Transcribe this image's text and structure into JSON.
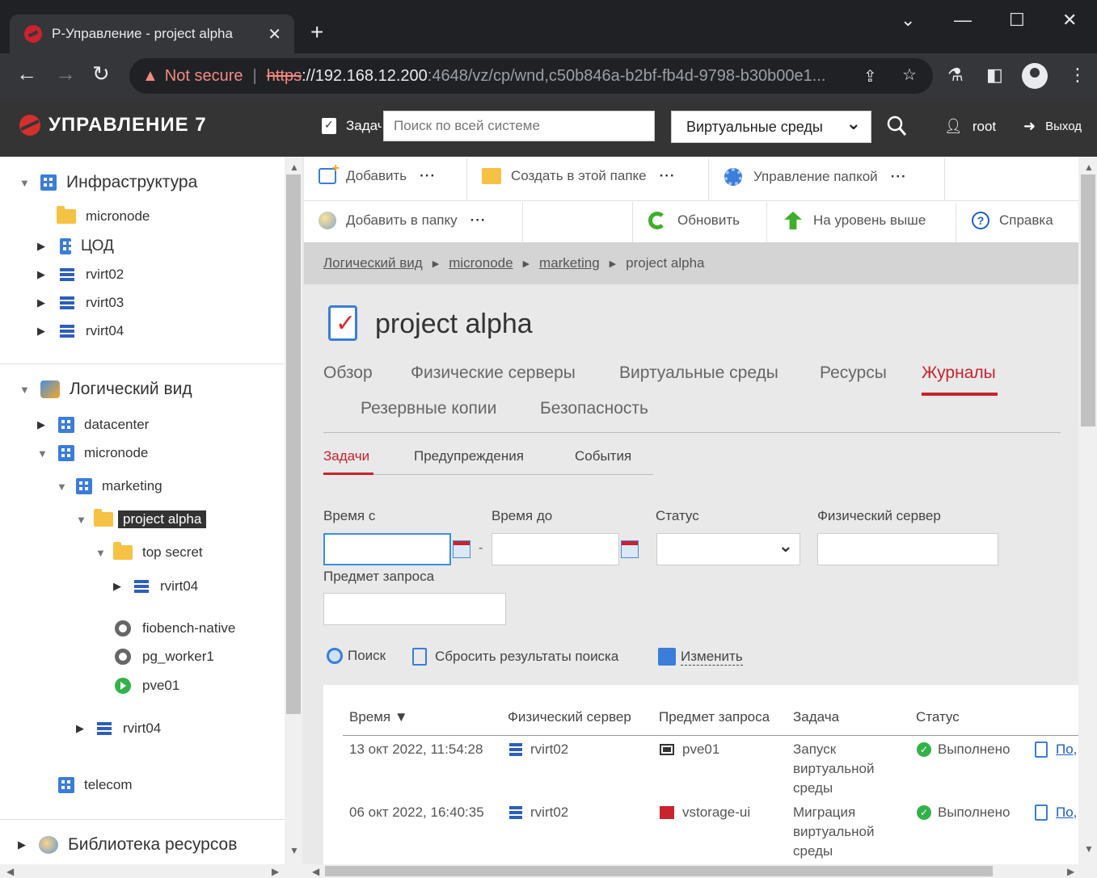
{
  "browser": {
    "tab_title": "Р-Управление - project alpha",
    "tab_close": "✕",
    "new_tab": "+",
    "not_secure": "Not secure",
    "url_scheme": "https",
    "url_host": "://192.168.12.200",
    "url_rest": ":4648/vz/cp/wnd,c50b846a-b2bf-fb4d-9798-b30b00e1..."
  },
  "app": {
    "logo_text": "УПРАВЛЕНИЕ 7",
    "tasks_label": "Задачи",
    "search_placeholder": "Поиск по всей системе",
    "scope_value": "Виртуальные среды",
    "user": "root",
    "logout": "Выход"
  },
  "sidebar": {
    "infra": {
      "label": "Инфраструктура",
      "items": [
        "micronode",
        "ЦОД",
        "rvirt02",
        "rvirt03",
        "rvirt04"
      ]
    },
    "logical": {
      "label": "Логический вид",
      "datacenter": "datacenter",
      "micronode": "micronode",
      "marketing": "marketing",
      "project_alpha": "project alpha",
      "top_secret": "top secret",
      "rvirt04_a": "rvirt04",
      "vms": [
        "fiobench-native",
        "pg_worker1",
        "pve01"
      ],
      "rvirt04_b": "rvirt04",
      "telecom": "telecom"
    },
    "library": "Библиотека ресурсов"
  },
  "toolbar": {
    "add": "Добавить",
    "create_in_folder": "Создать в этой папке",
    "manage_folder": "Управление папкой",
    "add_to_folder": "Добавить в папку",
    "refresh": "Обновить",
    "level_up": "На уровень выше",
    "help": "Справка",
    "more": "···"
  },
  "breadcrumb": [
    "Логический вид",
    "micronode",
    "marketing",
    "project alpha"
  ],
  "page": {
    "title": "project alpha",
    "tabs": [
      "Обзор",
      "Физические серверы",
      "Виртуальные среды",
      "Ресурсы",
      "Журналы",
      "Резервные копии",
      "Безопасность"
    ],
    "subtabs": [
      "Задачи",
      "Предупреждения",
      "События"
    ]
  },
  "filters": {
    "time_from": "Время с",
    "time_to": "Время до",
    "status": "Статус",
    "phys_server": "Физический сервер",
    "subject": "Предмет запроса",
    "search": "Поиск",
    "reset": "Сбросить результаты поиска",
    "edit": "Изменить",
    "dash": "-"
  },
  "table": {
    "headers": [
      "Время ▼",
      "Физический сервер",
      "Предмет запроса",
      "Задача",
      "Статус"
    ],
    "rows": [
      {
        "time": "13 окт 2022, 11:54:28",
        "server": "rvirt02",
        "subject": "pve01",
        "task": [
          "Запуск",
          "виртуальной",
          "среды"
        ],
        "status": "Выполнено",
        "link": "По,"
      },
      {
        "time": "06 окт 2022, 16:40:35",
        "server": "rvirt02",
        "subject": "vstorage-ui",
        "task": [
          "Миграция",
          "виртуальной",
          "среды"
        ],
        "status": "Выполнено",
        "link": "По,"
      }
    ]
  }
}
